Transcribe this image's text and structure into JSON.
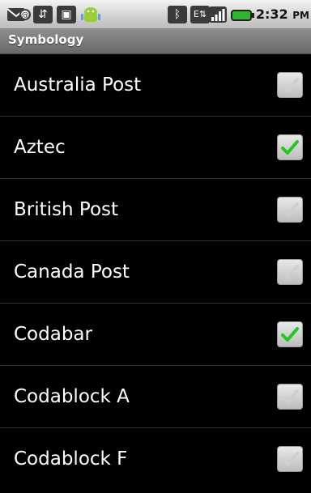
{
  "statusbar": {
    "time": "2:32",
    "ampm": "PM",
    "icons": [
      "email-notification-icon",
      "usb-icon",
      "android-debug-icon",
      "android-market-icon",
      "bluetooth-icon",
      "mobile-data-icon",
      "signal-strength-icon",
      "battery-icon"
    ],
    "battery_color": "#2fb52f"
  },
  "titlebar": {
    "title": "Symbology"
  },
  "colors": {
    "checked": "#1fc91f",
    "background": "#000000"
  },
  "list": {
    "items": [
      {
        "label": "Australia Post",
        "checked": false
      },
      {
        "label": "Aztec",
        "checked": true
      },
      {
        "label": "British Post",
        "checked": false
      },
      {
        "label": "Canada Post",
        "checked": false
      },
      {
        "label": "Codabar",
        "checked": true
      },
      {
        "label": "Codablock A",
        "checked": false
      },
      {
        "label": "Codablock F",
        "checked": false
      }
    ]
  }
}
